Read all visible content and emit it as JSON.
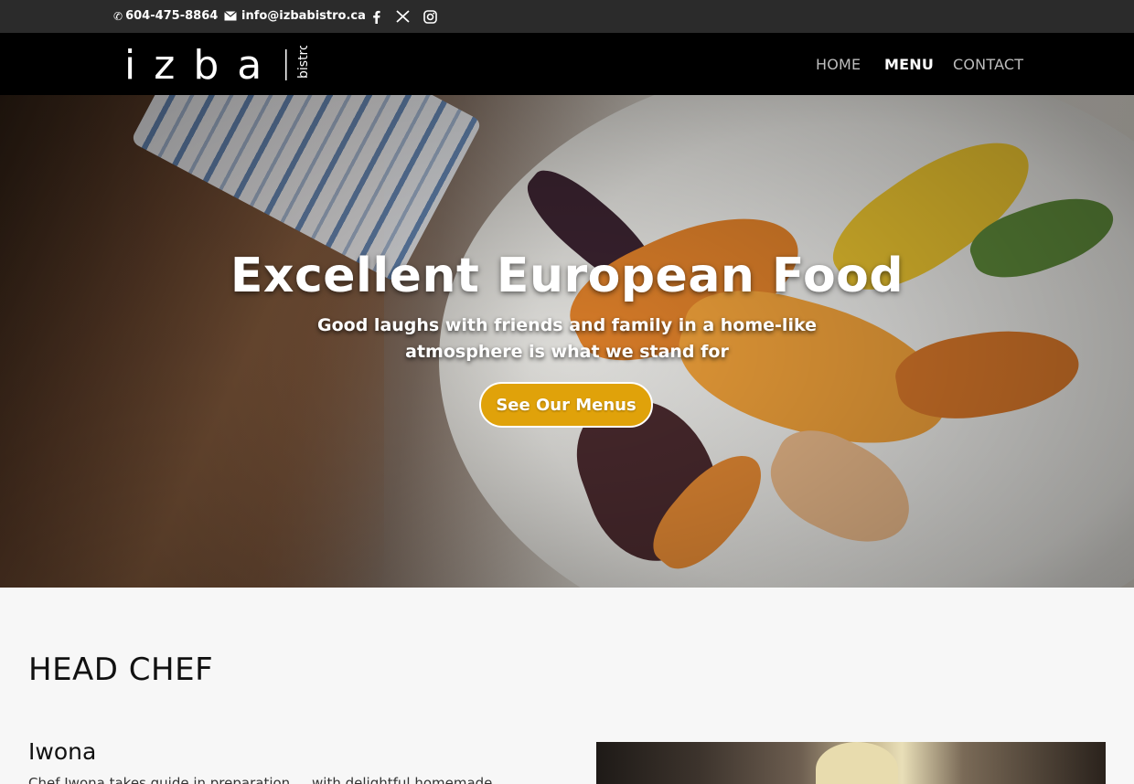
{
  "topbar": {
    "phone": "604-475-8864",
    "email": "info@izbabistro.ca",
    "social": [
      "facebook-icon",
      "x-icon",
      "instagram-icon"
    ]
  },
  "header": {
    "logo_text": "izba",
    "logo_subtext": "bistro",
    "nav": [
      {
        "label": "HOME",
        "active": false
      },
      {
        "label": "MENU",
        "active": true
      },
      {
        "label": "CONTACT",
        "active": false
      }
    ]
  },
  "hero": {
    "title": "Excellent European Food",
    "subtitle": "Good laughs with friends and family in a home-like atmosphere is what we stand for",
    "cta": "See Our Menus",
    "cta_color": "#e0a20a"
  },
  "chef": {
    "section_title": "HEAD CHEF",
    "name": "Iwona",
    "description": "Chef Iwona takes guide in preparation ... with delightful homemade"
  }
}
